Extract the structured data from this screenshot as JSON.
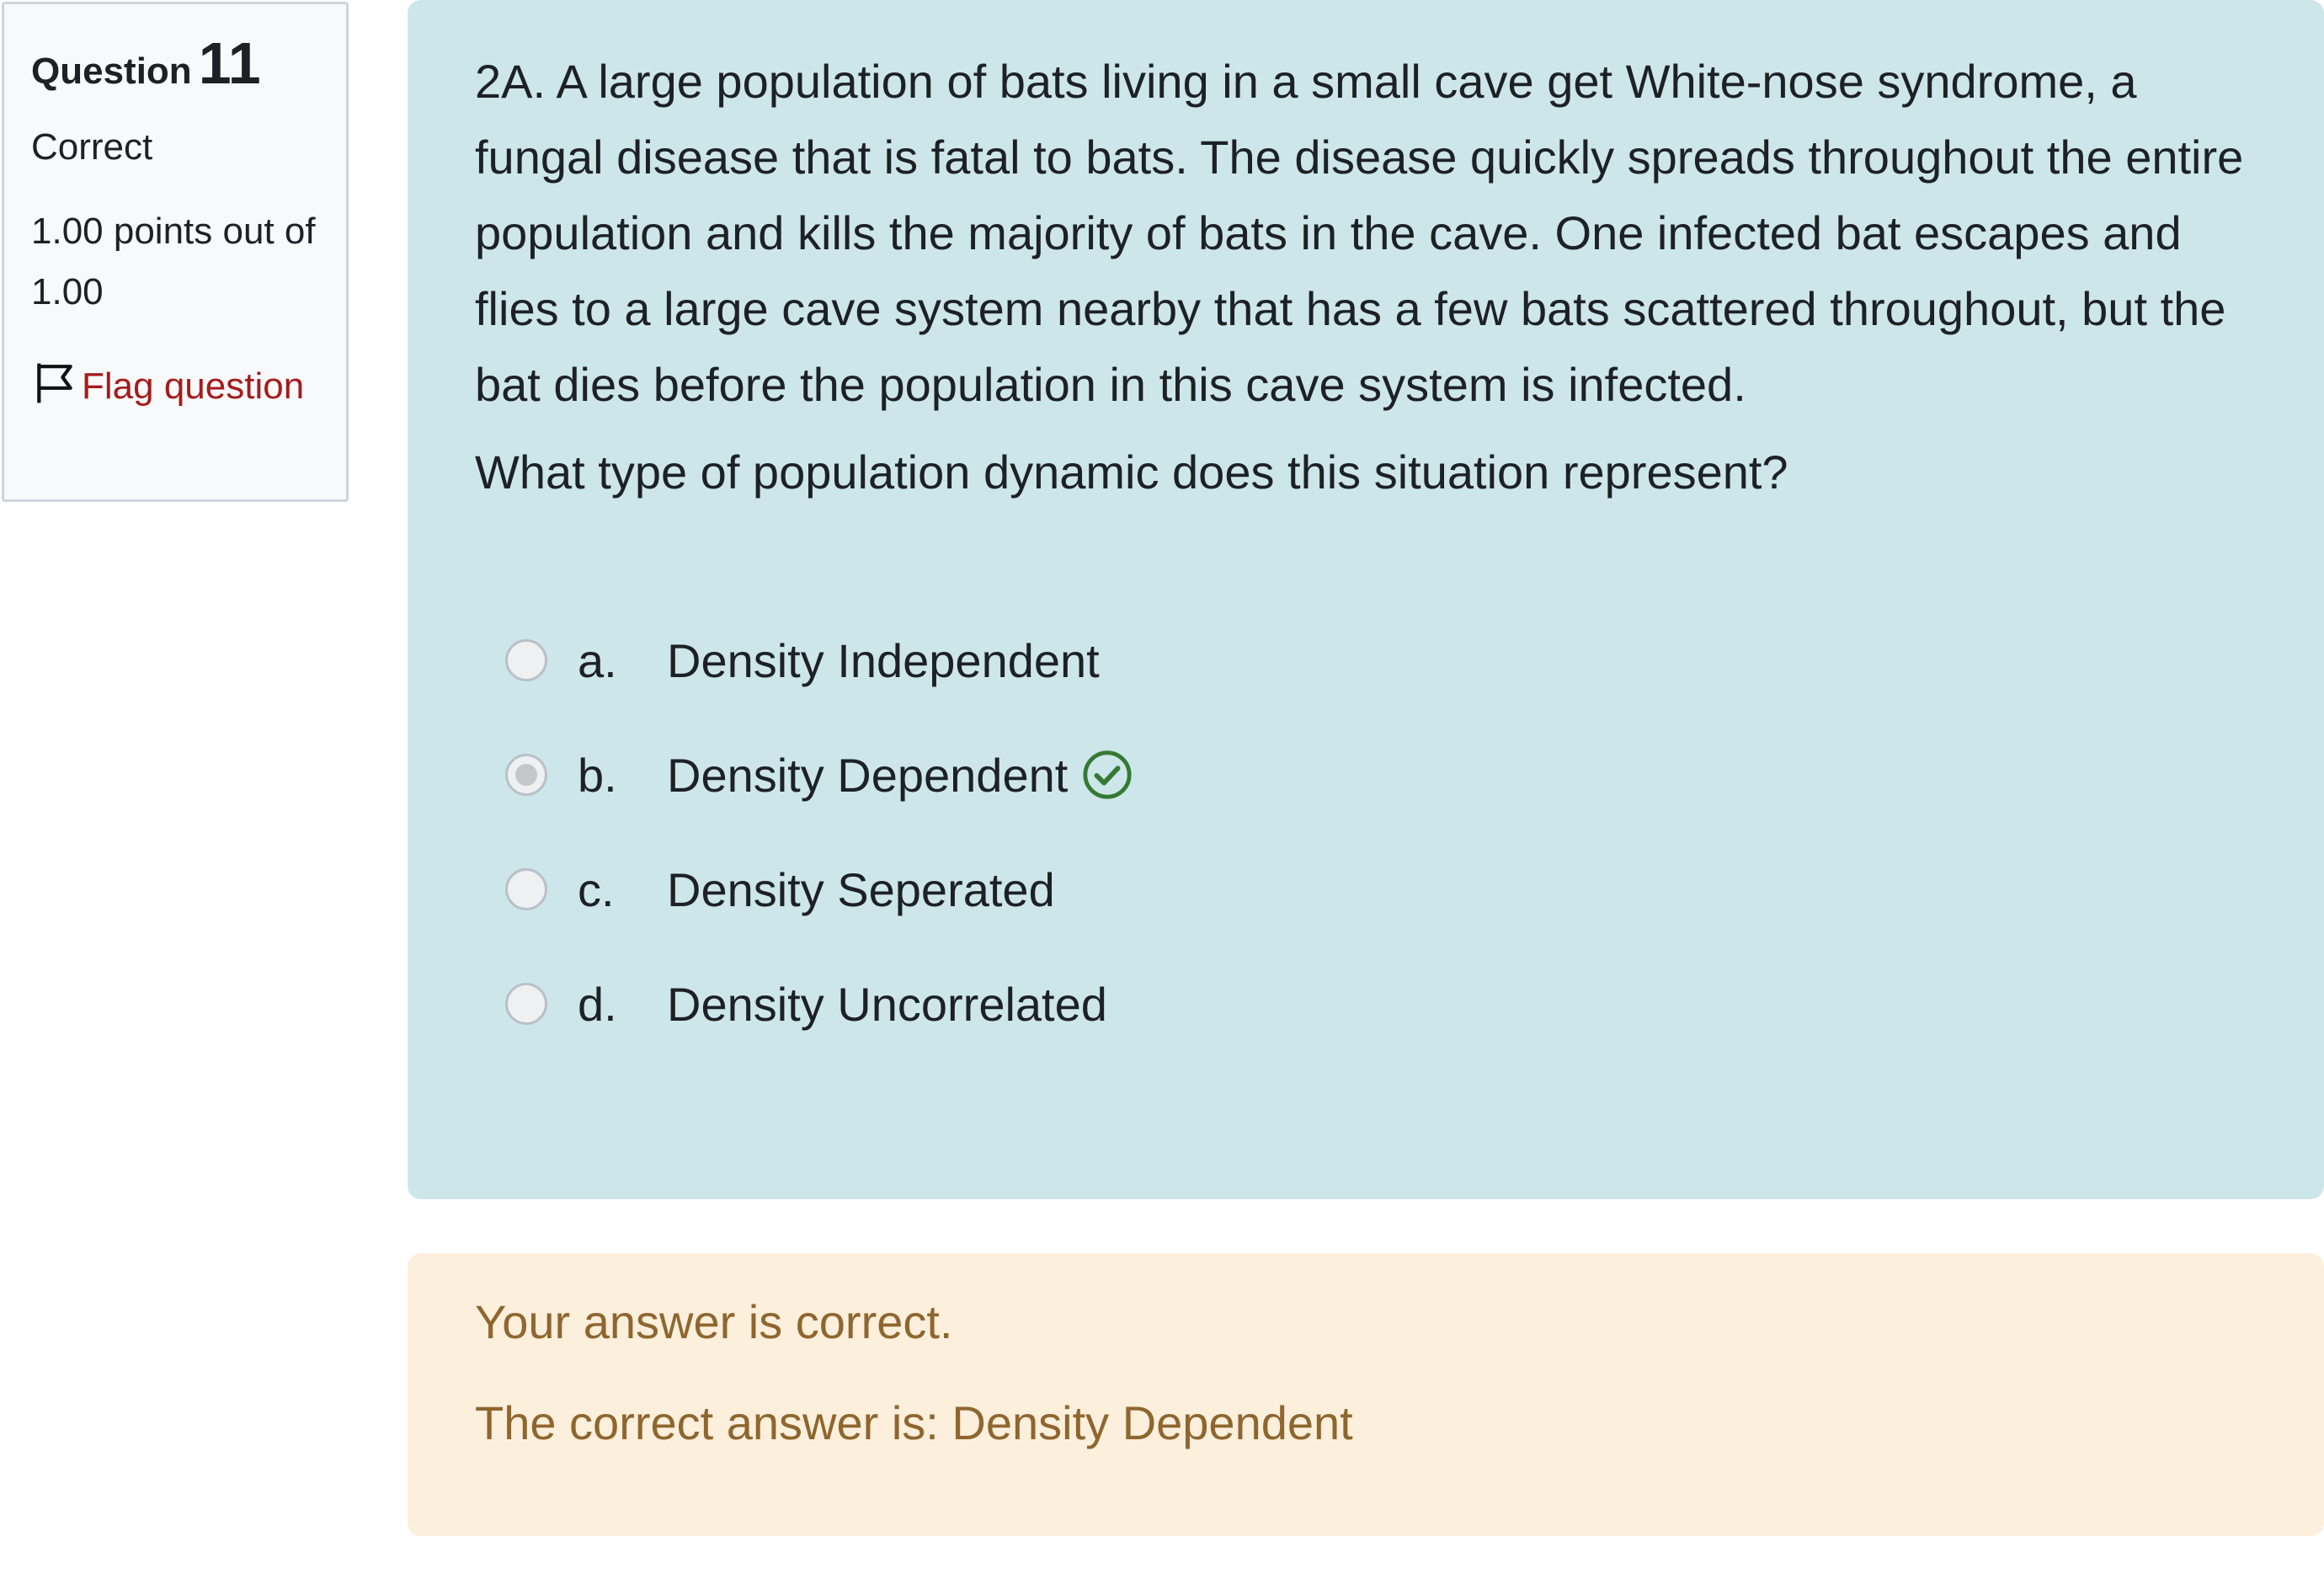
{
  "info": {
    "question_label": "Question",
    "question_number": "11",
    "state": "Correct",
    "grade": "1.00 points out of 1.00",
    "flag_label": "Flag question"
  },
  "question": {
    "text": "2A. A large population of bats living in a small cave get White-nose syndrome, a fungal disease that is fatal to bats. The disease quickly spreads throughout the entire population and kills the majority of bats in the cave. One infected bat escapes and flies to a large cave system nearby that has a few bats scattered throughout, but the bat dies before the population in this cave system is infected.",
    "prompt": "What type of population dynamic does this situation represent?"
  },
  "answers": [
    {
      "letter": "a.",
      "label": "Density Independent",
      "selected": false
    },
    {
      "letter": "b.",
      "label": "Density Dependent",
      "selected": true,
      "correct": true
    },
    {
      "letter": "c.",
      "label": "Density Seperated",
      "selected": false
    },
    {
      "letter": "d.",
      "label": "Density Uncorrelated",
      "selected": false
    }
  ],
  "feedback": {
    "specific": "Your answer is correct.",
    "right_answer": "The correct answer is: Density Dependent"
  },
  "colors": {
    "formulation_bg": "#cde6ea",
    "outcome_bg": "#fcefdc",
    "outcome_text": "#8e662e",
    "flag_text": "#a51c1c",
    "correct_icon": "#357a32"
  }
}
